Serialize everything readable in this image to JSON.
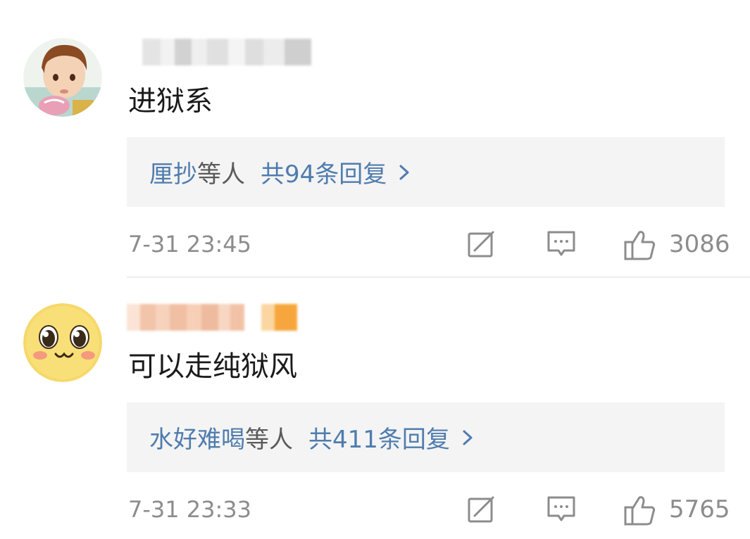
{
  "comments": [
    {
      "content": "进狱系",
      "reply": {
        "users": "厘抄",
        "users_suffix": "等人",
        "count_label": "共94条回复"
      },
      "time": "7-31 23:45",
      "likes": "3086",
      "avatar_icon": "child-photo-avatar",
      "username_icon": "blurred-username"
    },
    {
      "content": "可以走纯狱风",
      "reply": {
        "users": "水好难喝",
        "users_suffix": "等人",
        "count_label": "共411条回复"
      },
      "time": "7-31 23:33",
      "likes": "5765",
      "avatar_icon": "cute-emoji-face-avatar",
      "username_icon": "blurred-username"
    }
  ],
  "colors": {
    "link_blue": "#4f7cae",
    "meta_gray": "#8c8c8c",
    "reply_bg": "#f4f4f4"
  }
}
